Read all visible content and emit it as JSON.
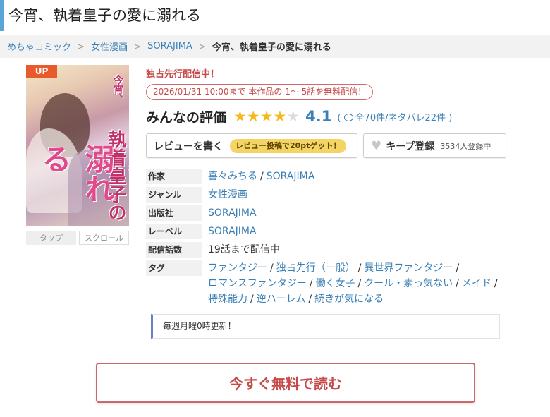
{
  "page": {
    "title": "今宵、執着皇子の愛に溺れる"
  },
  "breadcrumb": [
    {
      "label": "めちゃコミック"
    },
    {
      "label": "女性漫画"
    },
    {
      "label": "SORAJIMA"
    },
    {
      "label": "今宵、執着皇子の愛に溺れる"
    }
  ],
  "cover": {
    "badge": "UP",
    "art_title_small": "今宵、",
    "art_title_mid": "執着皇子の",
    "art_title_big": "愛に溺れる",
    "buttons": {
      "tap": "タップ",
      "scroll": "スクロール"
    }
  },
  "exclusive_label": "独占先行配信中！",
  "free_campaign": "2026/01/31 10:00まで 本作品の 1～ 5話を無料配信！",
  "rating": {
    "label": "みんなの評価",
    "score": "4.1",
    "stars_filled": 4,
    "stars_total": 5,
    "counts_prefix": "(",
    "counts": "全70件/ネタバレ22件",
    "counts_suffix": ")"
  },
  "actions": {
    "review_label": "レビューを書く",
    "review_bonus": "レビュー投稿で20ptゲット！",
    "keep_label": "キープ登録",
    "keep_count": "3534人登録中"
  },
  "info": {
    "author_key": "作家",
    "authors": [
      "喜々みちる",
      "SORAJIMA"
    ],
    "genre_key": "ジャンル",
    "genre": "女性漫画",
    "publisher_key": "出版社",
    "publisher": "SORAJIMA",
    "label_key": "レーベル",
    "label": "SORAJIMA",
    "episodes_key": "配信話数",
    "episodes": "19話まで配信中",
    "tags_key": "タグ",
    "tags": [
      "ファンタジー",
      "独占先行（一般）",
      "異世界ファンタジー",
      "ロマンスファンタジー",
      "働く女子",
      "クール・素っ気ない",
      "メイド",
      "特殊能力",
      "逆ハーレム",
      "続きが気になる"
    ]
  },
  "notice": "毎週月曜0時更新！",
  "cta": "今すぐ無料で読む",
  "colors": {
    "accent_blue": "#3a7fb5",
    "accent_red": "#c64a4a",
    "star": "#f5b91a",
    "badge_up": "#e85a2c",
    "bonus_pill": "#f3d464"
  }
}
